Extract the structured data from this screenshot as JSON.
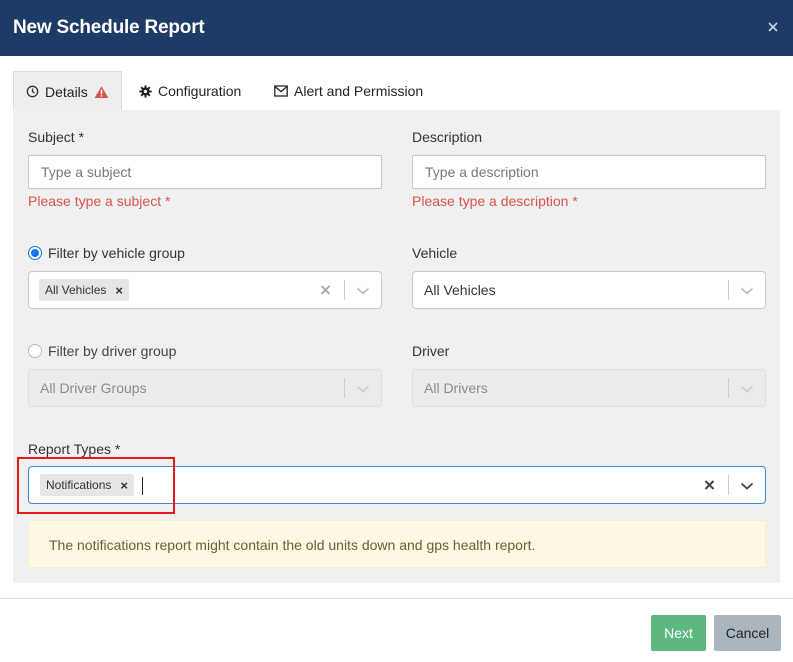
{
  "dialog": {
    "title": "New Schedule Report"
  },
  "tabs": [
    {
      "label": "Details",
      "icon": "clock-icon",
      "badge_icon": "warning-icon",
      "active": true
    },
    {
      "label": "Configuration",
      "icon": "gear-icon",
      "active": false
    },
    {
      "label": "Alert and Permission",
      "icon": "envelope-icon",
      "active": false
    }
  ],
  "details": {
    "subject": {
      "label": "Subject *",
      "placeholder": "Type a subject",
      "value": "",
      "error": "Please type a subject *"
    },
    "description": {
      "label": "Description",
      "placeholder": "Type a description",
      "value": "",
      "error": "Please type a description *"
    },
    "filter_vehicle_group": {
      "label": "Filter by vehicle group",
      "checked": true,
      "selected": [
        "All Vehicles"
      ]
    },
    "vehicle": {
      "label": "Vehicle",
      "value": "All Vehicles"
    },
    "filter_driver_group": {
      "label": "Filter by driver group",
      "checked": false,
      "value": "All Driver Groups"
    },
    "driver": {
      "label": "Driver",
      "value": "All Drivers"
    },
    "report_types": {
      "label": "Report Types *",
      "selected": [
        "Notifications"
      ]
    },
    "notice": "The notifications report might contain the old units down and gps health report."
  },
  "footer": {
    "next_label": "Next",
    "cancel_label": "Cancel"
  },
  "colors": {
    "header_bg": "#1e3a66",
    "error": "#d9534f",
    "radio_checked": "#1a73e8",
    "next_button": "#5cb87e",
    "cancel_button": "#aab6bf",
    "notice_bg": "#fcf8e3",
    "highlight": "#e01a1a"
  }
}
